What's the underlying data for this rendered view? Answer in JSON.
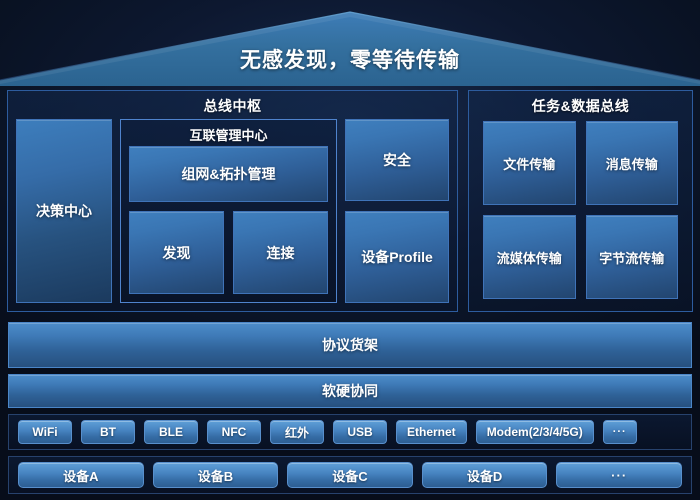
{
  "header": {
    "title": "无感发现，零等待传输"
  },
  "panels": {
    "bus_hub": {
      "title": "总线中枢",
      "decision": {
        "label": "决策中心"
      },
      "interconnect": {
        "title": "互联管理中心",
        "topology": "组网&拓扑管理",
        "discovery": "发现",
        "connect": "连接"
      },
      "side": {
        "security": "安全",
        "device_profile": "设备Profile"
      }
    },
    "task_data_bus": {
      "title": "任务&数据总线",
      "tiles": [
        "文件传输",
        "消息传输",
        "流媒体传输",
        "字节流传输"
      ]
    }
  },
  "bars": {
    "protocol_shelf": "协议货架",
    "hw_sw_collab": "软硬协同"
  },
  "protocol_chips": [
    {
      "label": "WiFi",
      "size": "normal"
    },
    {
      "label": "BT",
      "size": "normal"
    },
    {
      "label": "BLE",
      "size": "normal"
    },
    {
      "label": "NFC",
      "size": "normal"
    },
    {
      "label": "红外",
      "size": "normal"
    },
    {
      "label": "USB",
      "size": "normal"
    },
    {
      "label": "Ethernet",
      "size": "normal"
    },
    {
      "label": "Modem(2/3/4/5G)",
      "size": "wide"
    },
    {
      "label": "···",
      "size": "more"
    }
  ],
  "device_chips": [
    {
      "label": "设备A"
    },
    {
      "label": "设备B"
    },
    {
      "label": "设备C"
    },
    {
      "label": "设备D"
    },
    {
      "label": "···"
    }
  ],
  "colors": {
    "background": "#070d1a",
    "roof_fill": "#2f6ca8",
    "panel_border": "#2d5c9e",
    "subpanel_border": "#4f83cd",
    "tile_blue": "#3f7fbe",
    "bar_blue": "#4d8cc9",
    "chip_blue": "#5f9fd7",
    "text": "#ffffff"
  }
}
